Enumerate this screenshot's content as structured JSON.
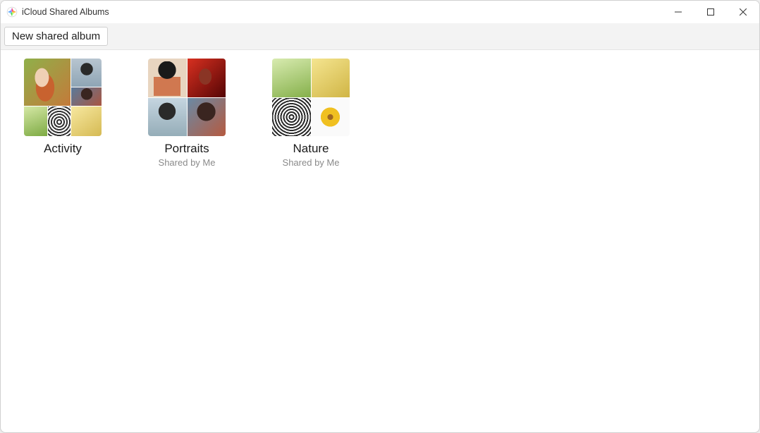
{
  "window": {
    "title": "iCloud Shared Albums"
  },
  "toolbar": {
    "new_album_label": "New shared album"
  },
  "albums": [
    {
      "title": "Activity",
      "subtitle": ""
    },
    {
      "title": "Portraits",
      "subtitle": "Shared by Me"
    },
    {
      "title": "Nature",
      "subtitle": "Shared by Me"
    }
  ]
}
